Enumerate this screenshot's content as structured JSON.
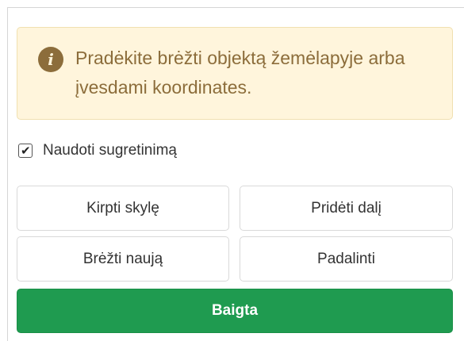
{
  "info": {
    "icon": "info-icon",
    "icon_glyph": "i",
    "text": "Pradėkite brėžti objektą žemėlapyje arba įvesdami koordinates.",
    "colors": {
      "background": "#fff5dc",
      "border": "#f0e0b0",
      "text": "#8c6d3b"
    }
  },
  "snapping": {
    "label": "Naudoti sugretinimą",
    "checked": true,
    "check_glyph": "✔"
  },
  "actions": {
    "cut_hole_label": "Kirpti skylę",
    "add_part_label": "Pridėti dalį",
    "draw_new_label": "Brėžti naują",
    "split_label": "Padalinti",
    "done_label": "Baigta"
  },
  "colors": {
    "primary": "#1f9b50",
    "primary_text": "#ffffff"
  }
}
